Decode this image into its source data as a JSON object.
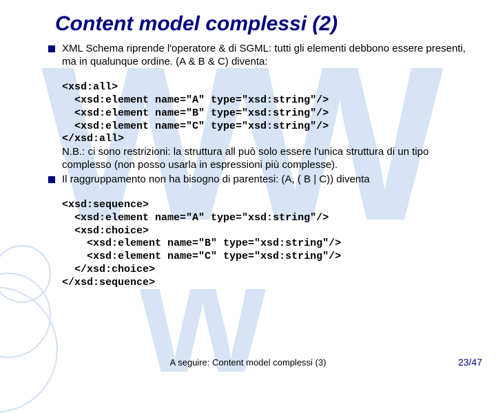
{
  "title": "Content model complessi (2)",
  "bullets": {
    "b1": {
      "text": "XML Schema riprende l'operatore & di SGML: tutti gli elementi debbono essere presenti, ma in qualunque ordine. (A & B & C) diventa:"
    },
    "b2": {
      "text": "Il raggruppamento non ha bisogno di parentesi: (A, ( B | C)) diventa"
    }
  },
  "code1": {
    "l1": "<xsd:all>",
    "l2": "<xsd:element name=\"A\" type=\"xsd:string\"/>",
    "l3": "<xsd:element name=\"B\" type=\"xsd:string\"/>",
    "l4": "<xsd:element name=\"C\" type=\"xsd:string\"/>",
    "l5": "</xsd:all>"
  },
  "nb": "N.B.: ci sono restrizioni: la struttura all può solo essere l'unica struttura di un tipo complesso (non posso usarla in espressioni più complesse).",
  "code2": {
    "l1": "<xsd:sequence>",
    "l2": "<xsd:element name=\"A\" type=\"xsd:string\"/>",
    "l3": "<xsd:choice>",
    "l4": "<xsd:element name=\"B\" type=\"xsd:string\"/>",
    "l5": "<xsd:element name=\"C\" type=\"xsd:string\"/>",
    "l6": "</xsd:choice>",
    "l7": "</xsd:sequence>"
  },
  "footer": "A seguire: Content model complessi (3)",
  "pagenum": "23/47",
  "watermark": "WW"
}
